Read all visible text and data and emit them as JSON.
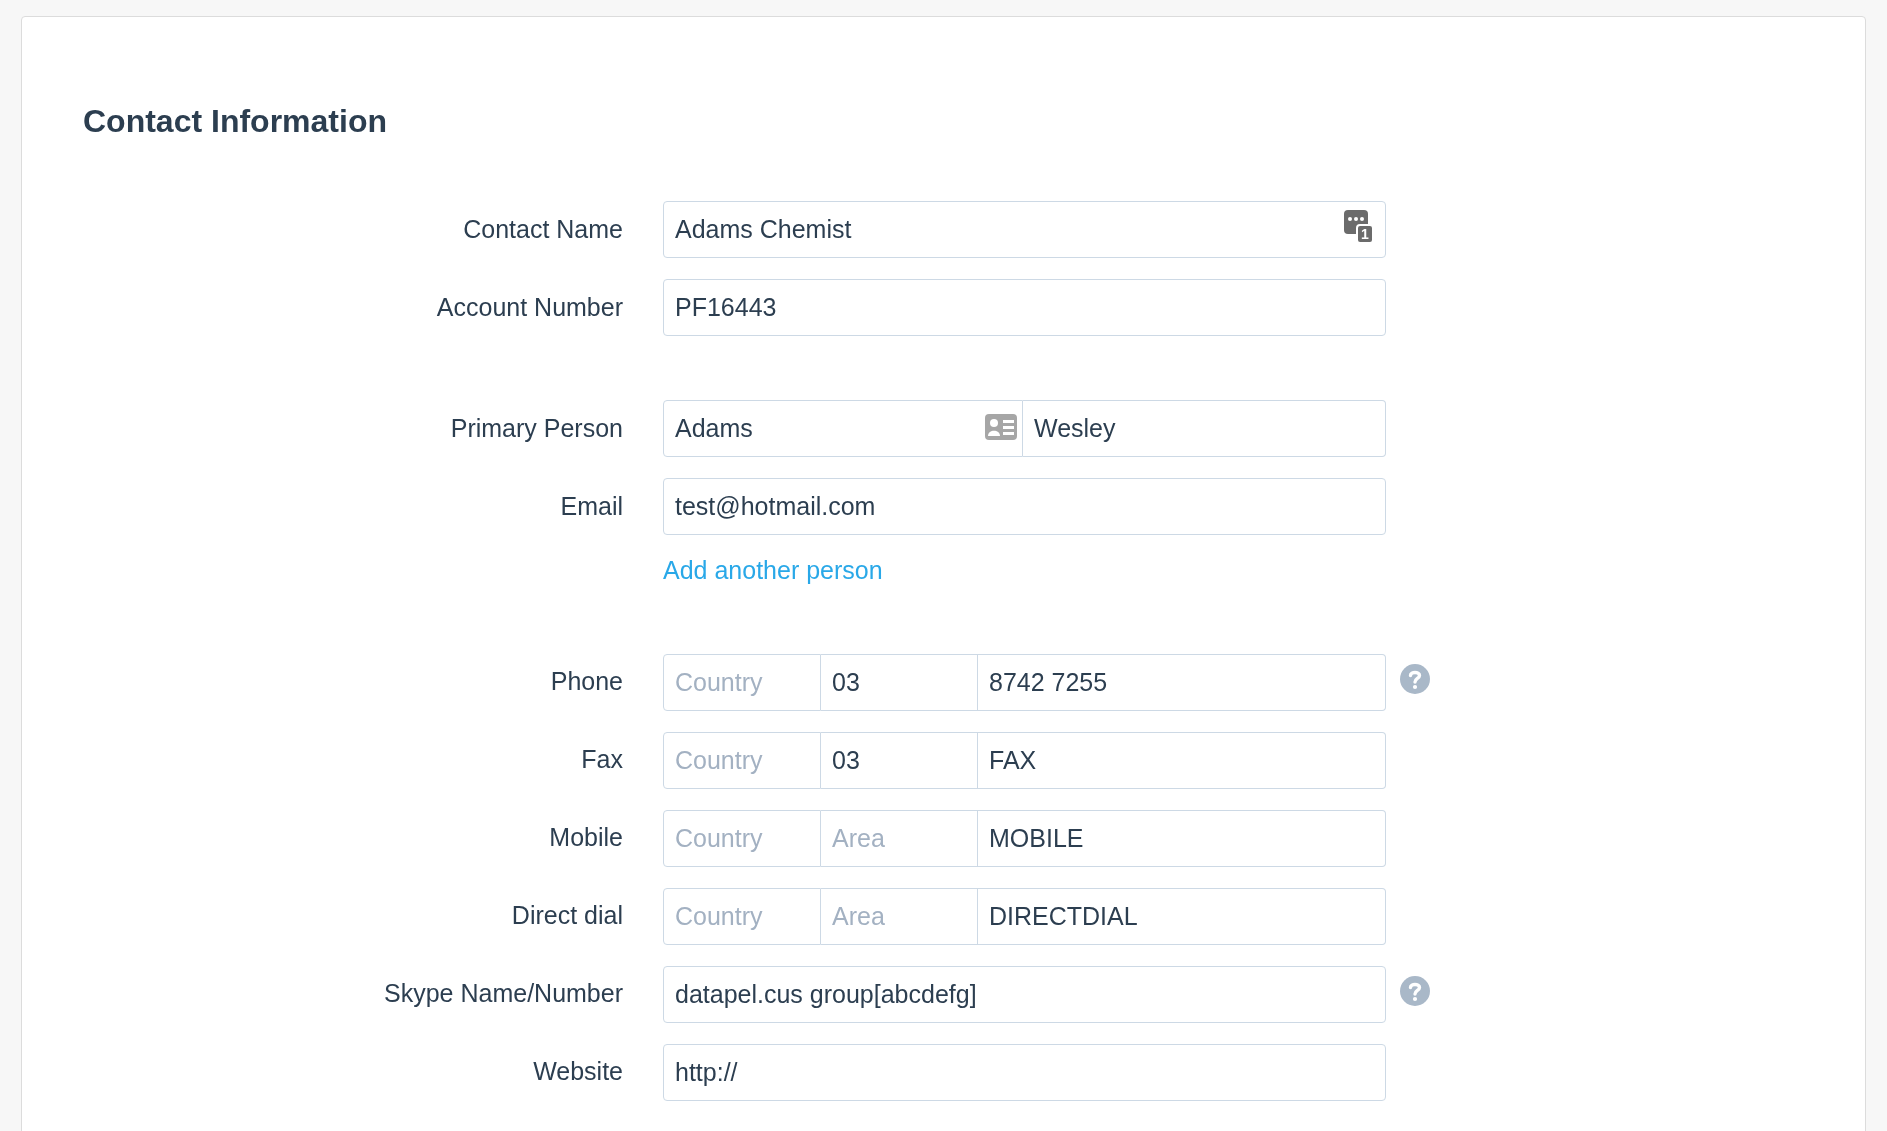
{
  "section": {
    "title": "Contact Information"
  },
  "groups": [
    {
      "rows": [
        {
          "kind": "text",
          "label": "Contact Name",
          "value": "Adams Chemist",
          "badge_count": "1",
          "help": false
        },
        {
          "kind": "text",
          "label": "Account Number",
          "value": "PF16443",
          "help": false
        }
      ]
    },
    {
      "rows": [
        {
          "kind": "name_pair",
          "label": "Primary Person",
          "parts": [
            {
              "value": "Adams"
            },
            {
              "value": "Wesley"
            }
          ],
          "help": false
        },
        {
          "kind": "text",
          "label": "Email",
          "value": "test@hotmail.com",
          "help": false
        },
        {
          "kind": "link",
          "text": "Add another person"
        }
      ]
    },
    {
      "rows": [
        {
          "kind": "phone",
          "label": "Phone",
          "parts": [
            {
              "placeholder": "Country"
            },
            {
              "value": "03"
            },
            {
              "value": "8742 7255"
            }
          ],
          "help": true
        },
        {
          "kind": "phone",
          "label": "Fax",
          "parts": [
            {
              "placeholder": "Country"
            },
            {
              "value": "03"
            },
            {
              "value": "FAX"
            }
          ],
          "help": false
        },
        {
          "kind": "phone",
          "label": "Mobile",
          "parts": [
            {
              "placeholder": "Country"
            },
            {
              "placeholder": "Area"
            },
            {
              "value": "MOBILE"
            }
          ],
          "help": false
        },
        {
          "kind": "phone",
          "label": "Direct dial",
          "parts": [
            {
              "placeholder": "Country"
            },
            {
              "placeholder": "Area"
            },
            {
              "value": "DIRECTDIAL"
            }
          ],
          "help": false
        },
        {
          "kind": "text",
          "label": "Skype Name/Number",
          "value": "datapel.cus group[abcdefg]",
          "help": true
        },
        {
          "kind": "text",
          "label": "Website",
          "value": "http://",
          "help": false
        }
      ]
    }
  ]
}
